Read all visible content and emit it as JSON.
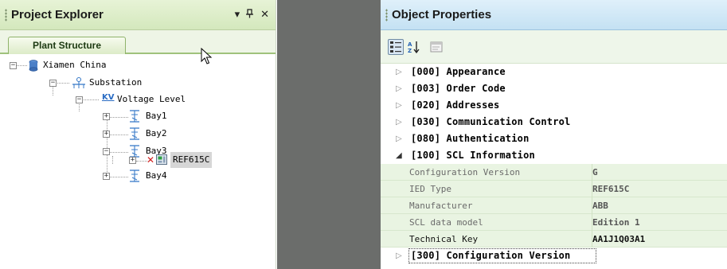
{
  "explorer": {
    "title": "Project Explorer",
    "controls": [
      "▾",
      "ꟼ",
      "✕"
    ],
    "tab_label": "Plant Structure",
    "tree": {
      "root": "Xiamen China",
      "substation": "Substation",
      "voltage_level": "Voltage Level",
      "bay1": "Bay1",
      "bay2": "Bay2",
      "bay3": "Bay3",
      "ied": "REF615C",
      "bay4": "Bay4",
      "kv_glyph": "KV"
    }
  },
  "properties": {
    "title": "Object Properties",
    "categories": [
      "[000] Appearance",
      "[003] Order Code",
      "[020] Addresses",
      "[030] Communication Control",
      "[080] Authentication",
      "[100] SCL Information",
      "[300] Configuration Version"
    ],
    "scl_rows": [
      {
        "name": "Configuration Version",
        "value": "G"
      },
      {
        "name": "IED Type",
        "value": "REF615C"
      },
      {
        "name": "Manufacturer",
        "value": "ABB"
      },
      {
        "name": "SCL data model",
        "value": "Edition 1"
      },
      {
        "name": "Technical Key",
        "value": "AA1J1Q03A1"
      }
    ],
    "arrow_closed": "▷",
    "arrow_open": "◢"
  },
  "colors": {
    "explorer_header": "#d4e8bd",
    "properties_header": "#c4e1f3",
    "property_row": "#e9f4e2",
    "splitter": "#6b6d6b"
  }
}
